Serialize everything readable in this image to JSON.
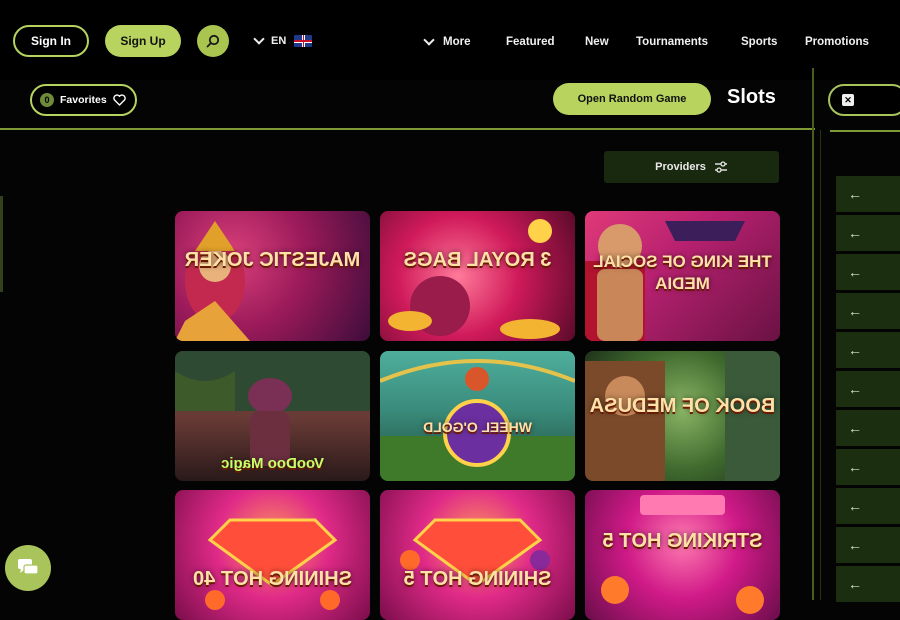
{
  "header": {
    "sign_in": "Sign In",
    "sign_up": "Sign Up",
    "language": "EN",
    "language_flag": "uk-flag",
    "nav": [
      {
        "label": "More",
        "has_chevron": true
      },
      {
        "label": "Featured"
      },
      {
        "label": "New"
      },
      {
        "label": "Tournaments"
      },
      {
        "label": "Sports"
      },
      {
        "label": "Promotions"
      }
    ]
  },
  "subbar": {
    "favorites_label": "Favorites",
    "favorites_count": "0",
    "random_game": "Open Random Game",
    "page_title": "Slots"
  },
  "providers_label": "Providers",
  "games": [
    {
      "title": "MAJESTIC JOKER"
    },
    {
      "title": "3 ROYAL BAGS"
    },
    {
      "title": "THE KING OF SOCIAL MEDIA"
    },
    {
      "title": "VooDoo Magic"
    },
    {
      "title": "WHEEL O'GOLD"
    },
    {
      "title": "BOOK OF MEDUSA"
    },
    {
      "title": "SHINING HOT 40"
    },
    {
      "title": "SHINING HOT 5"
    },
    {
      "title": "STRIKING HOT 5"
    }
  ],
  "rail_arrow": "←",
  "colors": {
    "accent": "#b8d45e",
    "rail_item": "#1b2f10",
    "background": "#040404"
  }
}
